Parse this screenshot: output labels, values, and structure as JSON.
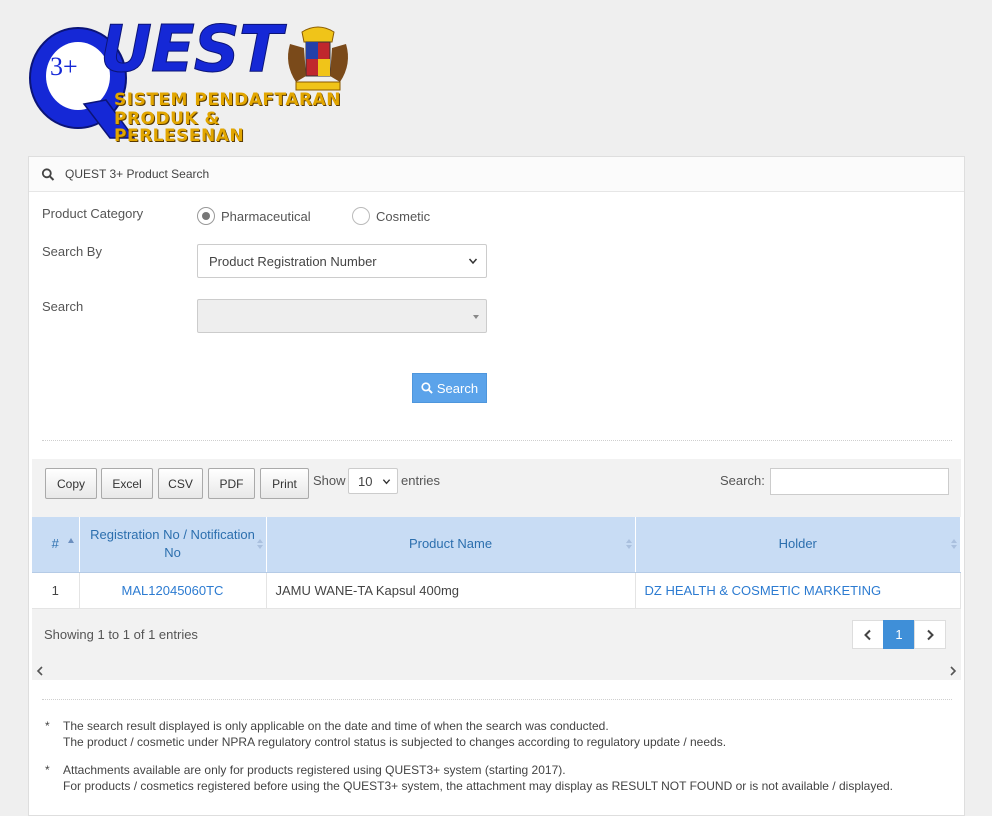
{
  "logo": {
    "three": "3+",
    "quest": "UEST",
    "line1": "SISTEM PENDAFTARAN",
    "line2": "PRODUK & PERLESENAN"
  },
  "panel": {
    "title": "QUEST 3+ Product Search"
  },
  "form": {
    "category_label": "Product Category",
    "category_options": [
      "Pharmaceutical",
      "Cosmetic"
    ],
    "category_selected": "Pharmaceutical",
    "search_by_label": "Search By",
    "search_by_value": "Product Registration Number",
    "search_label": "Search",
    "search_value": "",
    "search_button": "Search"
  },
  "table_tools": {
    "buttons": [
      "Copy",
      "Excel",
      "CSV",
      "PDF",
      "Print"
    ],
    "show_label": "Show",
    "entries_value": "10",
    "entries_label": "entries",
    "search_label": "Search:"
  },
  "table": {
    "headers": [
      "#",
      "Registration No / Notification No",
      "Product Name",
      "Holder"
    ],
    "rows": [
      {
        "num": "1",
        "reg_no": "MAL12045060TC",
        "product": "JAMU WANE-TA Kapsul 400mg",
        "holder": "DZ HEALTH & COSMETIC MARKETING"
      }
    ],
    "info": "Showing 1 to 1 of 1 entries",
    "current_page": "1"
  },
  "notes": [
    {
      "mark": "*",
      "line1": "The search result displayed is only applicable on the date and time of when the search was conducted.",
      "line2": "The product / cosmetic under NPRA regulatory control status is subjected to changes according to regulatory update / needs."
    },
    {
      "mark": "*",
      "line1": "Attachments available are only for products registered using QUEST3+ system (starting 2017).",
      "line2": "For products / cosmetics registered before using the QUEST3+ system, the attachment may display as RESULT NOT FOUND or is not available / displayed."
    }
  ],
  "colors": {
    "accent": "#5ba3ea",
    "header_bg": "#c8dcf4",
    "link": "#2c7bd1",
    "logo_blue": "#1528d6",
    "logo_gold": "#e2a600"
  }
}
